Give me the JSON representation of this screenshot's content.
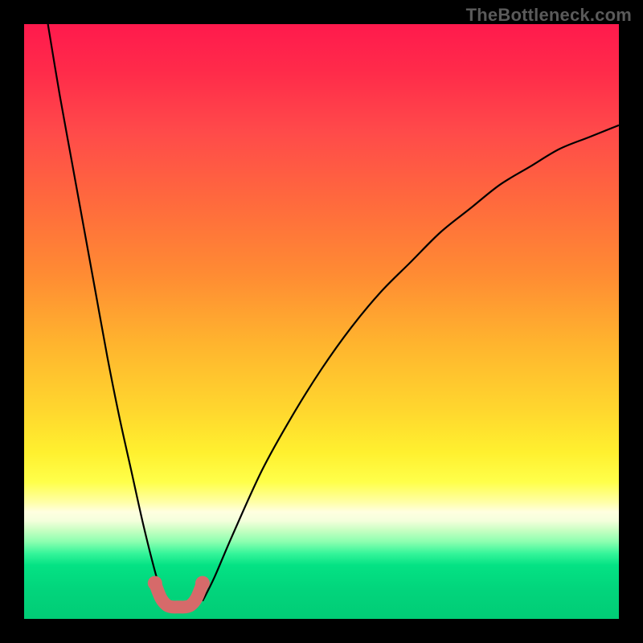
{
  "watermark": "TheBottleneck.com",
  "colors": {
    "background": "#000000",
    "curve": "#000000",
    "trough": "#d66a6a",
    "gradient_top": "#ff1a4d",
    "gradient_bottom": "#01cc76"
  },
  "chart_data": {
    "type": "line",
    "title": "",
    "xlabel": "",
    "ylabel": "",
    "xlim": [
      0,
      100
    ],
    "ylim": [
      0,
      100
    ],
    "grid": false,
    "legend": false,
    "annotations": [],
    "series": [
      {
        "name": "left_branch",
        "x": [
          4,
          6,
          8,
          10,
          12,
          14,
          16,
          18,
          20,
          22,
          23.5
        ],
        "y": [
          100,
          88,
          77,
          66,
          55,
          44,
          34,
          25,
          16,
          8,
          3
        ]
      },
      {
        "name": "right_branch",
        "x": [
          30,
          32,
          35,
          40,
          45,
          50,
          55,
          60,
          65,
          70,
          75,
          80,
          85,
          90,
          95,
          100
        ],
        "y": [
          3,
          7,
          14,
          25,
          34,
          42,
          49,
          55,
          60,
          65,
          69,
          73,
          76,
          79,
          81,
          83
        ]
      },
      {
        "name": "trough_highlight",
        "x": [
          22,
          23,
          24,
          25,
          26,
          27,
          28,
          29,
          30
        ],
        "y": [
          6,
          3.5,
          2.3,
          2,
          2,
          2,
          2.3,
          3.5,
          6
        ]
      }
    ],
    "minimum": {
      "x": 26.5,
      "y": 2
    }
  }
}
